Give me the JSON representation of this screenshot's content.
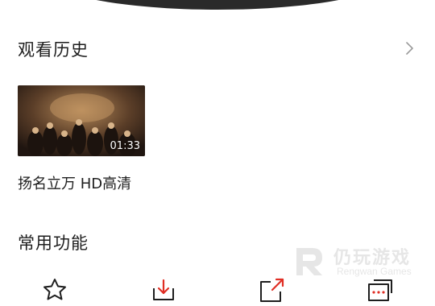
{
  "history": {
    "title": "观看历史",
    "items": [
      {
        "title": "扬名立万 HD高清",
        "duration": "01:33"
      }
    ]
  },
  "functions": {
    "title": "常用功能",
    "items": [
      {
        "icon": "star-icon"
      },
      {
        "icon": "download-icon"
      },
      {
        "icon": "share-icon"
      },
      {
        "icon": "message-icon"
      }
    ]
  },
  "watermark": {
    "title": "仍玩游戏",
    "subtitle": "Rengwan Games"
  },
  "colors": {
    "download_accent": "#e02e24",
    "text": "#1e1e1e"
  }
}
